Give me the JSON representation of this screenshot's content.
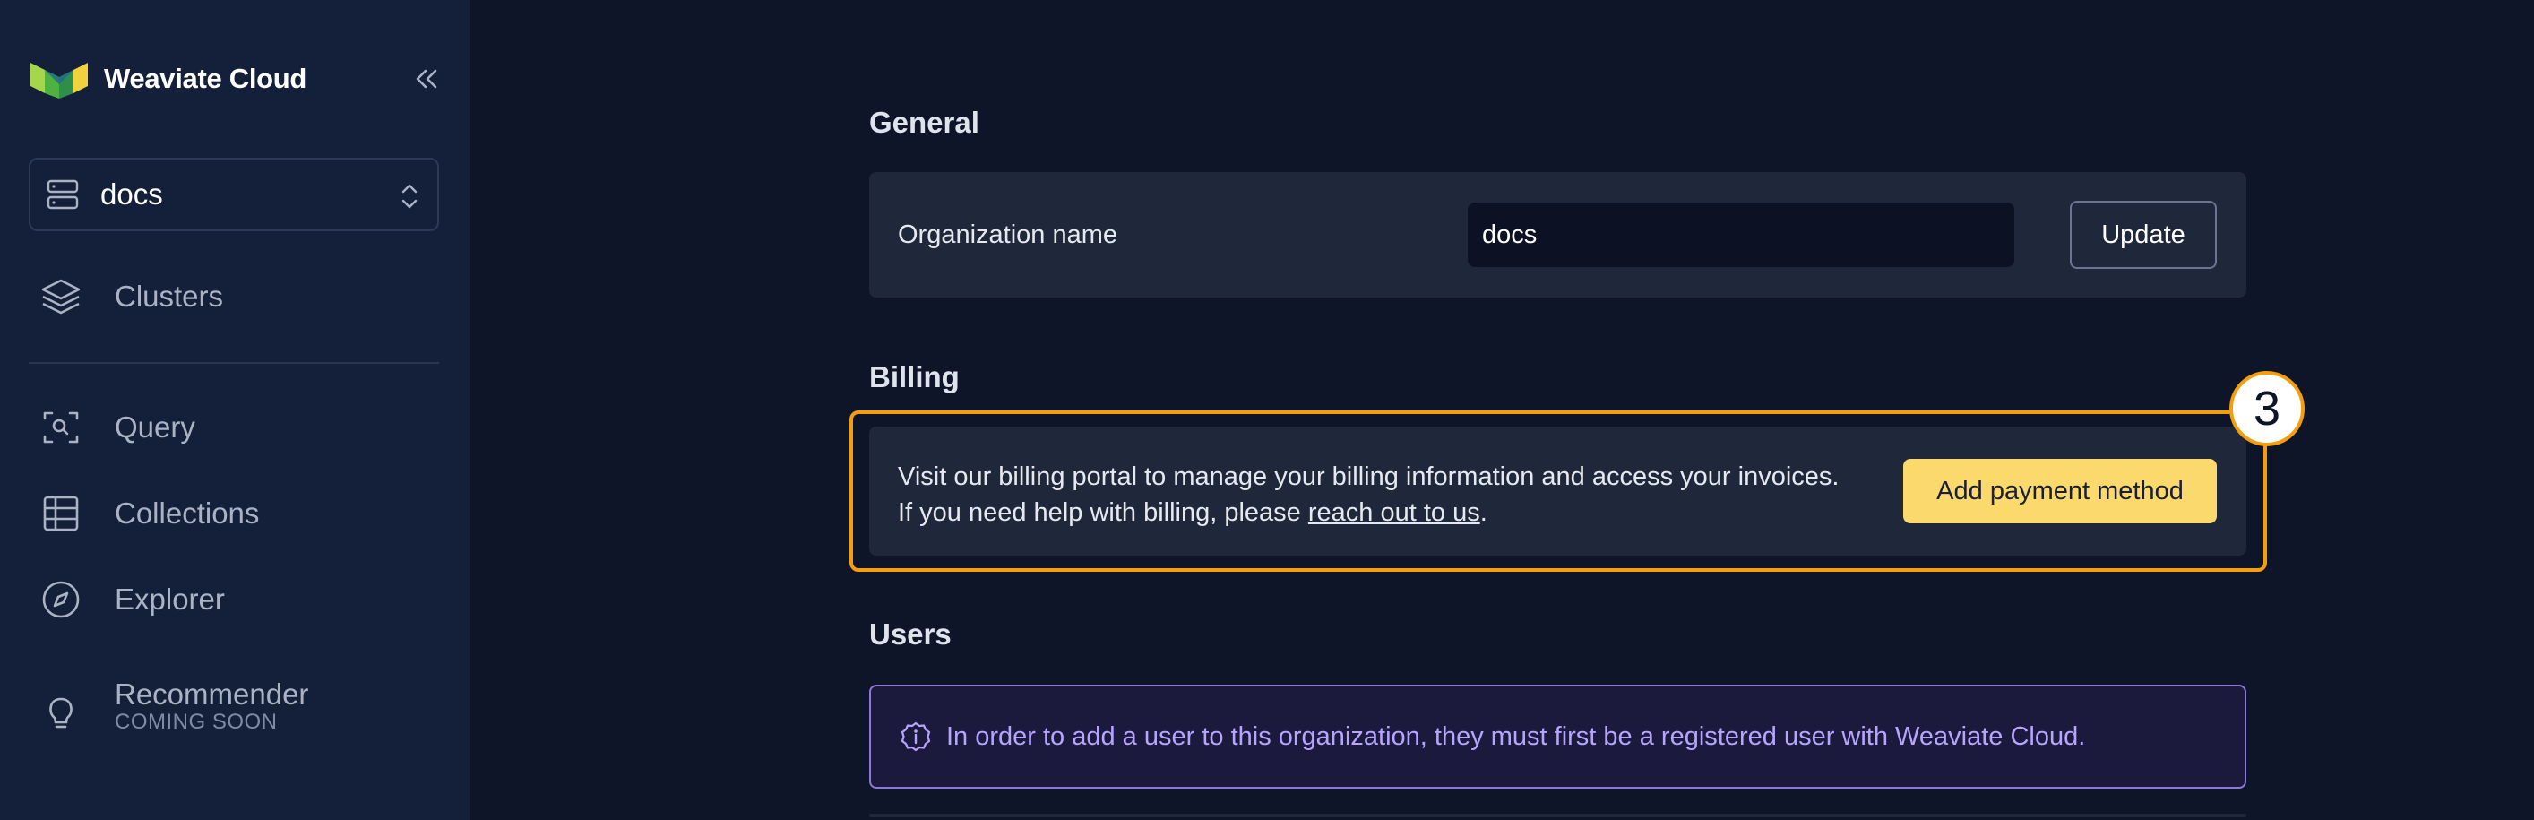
{
  "sidebar": {
    "brand_name": "Weaviate Cloud",
    "org_selector": {
      "value": "docs"
    },
    "nav": [
      {
        "label": "Clusters",
        "icon": "layers-icon"
      },
      {
        "label": "Query",
        "icon": "scan-search-icon"
      },
      {
        "label": "Collections",
        "icon": "table-icon"
      },
      {
        "label": "Explorer",
        "icon": "compass-icon"
      },
      {
        "label": "Recommender",
        "sub": "COMING SOON",
        "icon": "lightbulb-icon"
      }
    ]
  },
  "general": {
    "title": "General",
    "org_name_label": "Organization name",
    "org_name_value": "docs",
    "update_label": "Update"
  },
  "billing": {
    "title": "Billing",
    "line1": "Visit our billing portal to manage your billing information and access your invoices.",
    "line2_prefix": "If you need help with billing, please ",
    "link_text": "reach out to us",
    "line2_suffix": ".",
    "button_label": "Add payment method",
    "step_number": "3"
  },
  "users": {
    "title": "Users",
    "info_text": "In order to add a user to this organization, they must first be a registered user with Weaviate Cloud."
  },
  "colors": {
    "background": "#0e1529",
    "sidebar": "#14203a",
    "card": "#1f283b",
    "highlight": "#f59e0b",
    "primary_button": "#fbd96c",
    "info_border": "#8c7ad6",
    "info_text": "#b7a4ff"
  }
}
